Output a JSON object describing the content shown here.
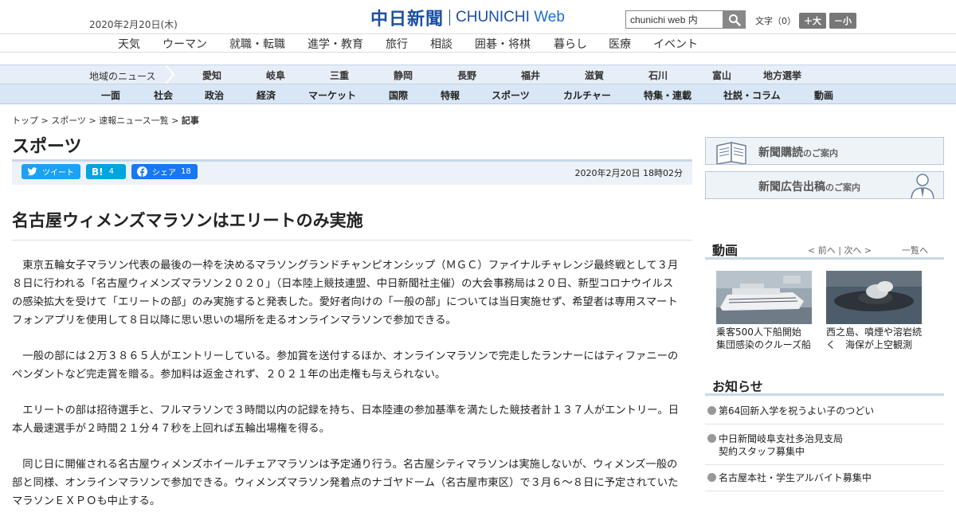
{
  "header": {
    "date": "2020年2月20日(木)",
    "logo_jp": "中日新聞",
    "logo_en": "CHUNICHI",
    "logo_web": "Web",
    "search_value": "chunichi web 内",
    "font_label": "文字（0）",
    "font_larger": "＋大",
    "font_smaller": "－小"
  },
  "top_nav": [
    "天気",
    "ウーマン",
    "就職・転職",
    "進学・教育",
    "旅行",
    "相談",
    "囲碁・将棋",
    "暮らし",
    "医療",
    "イベント"
  ],
  "region_nav": {
    "label": "地域のニュース",
    "items": [
      "愛知",
      "岐阜",
      "三重",
      "静岡",
      "長野",
      "福井",
      "滋賀",
      "石川",
      "富山",
      "地方選挙"
    ]
  },
  "main_nav": [
    "一面",
    "社会",
    "政治",
    "経済",
    "マーケット",
    "国際",
    "特報",
    "スポーツ",
    "カルチャー",
    "特集・連載",
    "社説・コラム",
    "動画"
  ],
  "breadcrumb": "トップ > スポーツ > 速報ニュース一覧 > ",
  "breadcrumb_current": "記事",
  "section_title": "スポーツ",
  "share": {
    "tweet": "ツイート",
    "hatena_label": "B!",
    "hatena_count": "4",
    "fb_label": "シェア",
    "fb_count": "18",
    "pubdate": "2020年2月20日 18時02分"
  },
  "article": {
    "headline": "名古屋ウィメンズマラソンはエリートのみ実施",
    "paragraphs": [
      "東京五輪女子マラソン代表の最後の一枠を決めるマラソングランドチャンピオンシップ（ＭＧＣ）ファイナルチャレンジ最終戦として３月８日に行われる「名古屋ウィメンズマラソン２０２０」（日本陸上競技連盟、中日新聞社主催）の大会事務局は２０日、新型コロナウイルスの感染拡大を受けて「エリートの部」のみ実施すると発表した。愛好者向けの「一般の部」については当日実施せず、希望者は専用スマートフォンアプリを使用して８日以降に思い思いの場所を走るオンラインマラソンで参加できる。",
      "一般の部には２万３８６５人がエントリーしている。参加賞を送付するほか、オンラインマラソンで完走したランナーにはティファニーのペンダントなど完走賞を贈る。参加料は返金されず、２０２１年の出走権も与えられない。",
      "エリートの部は招待選手と、フルマラソンで３時間以内の記録を持ち、日本陸連の参加基準を満たした競技者計１３７人がエントリー。日本人最速選手が２時間２１分４７秒を上回れば五輪出場権を得る。",
      "同じ日に開催される名古屋ウィメンズホイールチェアマラソンは予定通り行う。名古屋シティマラソンは実施しないが、ウィメンズ一般の部と同様、オンラインマラソンで参加できる。ウィメンズマラソン発着点のナゴヤドーム（名古屋市東区）で３月６～８日に予定されていたマラソンＥＸＰＯも中止する。"
    ]
  },
  "sidebar": {
    "banner1": {
      "main": "新聞購読",
      "sub": "のご案内"
    },
    "banner2": {
      "main": "新聞広告出稿",
      "sub": "のご案内"
    },
    "video": {
      "title": "動画",
      "nav": "< 前へ | 次へ >",
      "all": "一覧へ",
      "items": [
        {
          "caption": "乗客500人下船開始　集団感染のクルーズ船"
        },
        {
          "caption": "西之島、噴煙や溶岩続く　海保が上空観測"
        }
      ]
    },
    "notices": {
      "title": "お知らせ",
      "items": [
        {
          "line1": "第64回新入学を祝うよい子のつどい",
          "line2": ""
        },
        {
          "line1": "中日新聞岐阜支社多治見支局",
          "line2": "契約スタッフ募集中"
        },
        {
          "line1": "名古屋本社・学生アルバイト募集中",
          "line2": ""
        }
      ]
    }
  },
  "colors": {
    "brand": "#1a4fa3",
    "nav_bg": "#d9e6f5",
    "twitter": "#1da1f2",
    "hatena": "#00a4de",
    "facebook": "#1877f2"
  }
}
